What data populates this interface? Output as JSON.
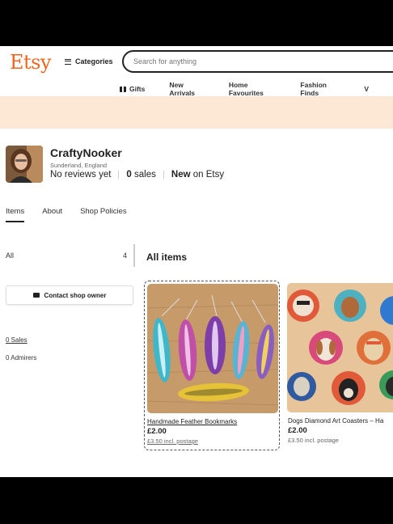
{
  "header": {
    "logo": "Etsy",
    "categories_label": "Categories",
    "search_placeholder": "Search for anything",
    "nav": [
      "Gifts",
      "New Arrivals",
      "Home Favourites",
      "Fashion Finds",
      "V"
    ]
  },
  "shop": {
    "name": "CraftyNooker",
    "location": "Sunderland, England",
    "reviews": "No reviews yet",
    "sales_count": "0",
    "sales_label": "sales",
    "new_label": "New",
    "on_etsy": "on Etsy"
  },
  "tabs": [
    "Items",
    "About",
    "Shop Policies"
  ],
  "sidebar": {
    "all_label": "All",
    "all_count": "4",
    "contact_label": "Contact shop owner",
    "sales_link": "0 Sales",
    "admirers": "0 Admirers"
  },
  "main": {
    "heading": "All items",
    "items": [
      {
        "title": "Handmade Feather Bookmarks",
        "price": "£2.00",
        "postage": "£3.50 incl. postage"
      },
      {
        "title": "Dogs Diamond Art Coasters – Ha",
        "price": "£2.00",
        "postage": "£3.50 incl. postage"
      }
    ]
  },
  "colors": {
    "brand": "#f1641e",
    "banner": "#fde8d6"
  }
}
